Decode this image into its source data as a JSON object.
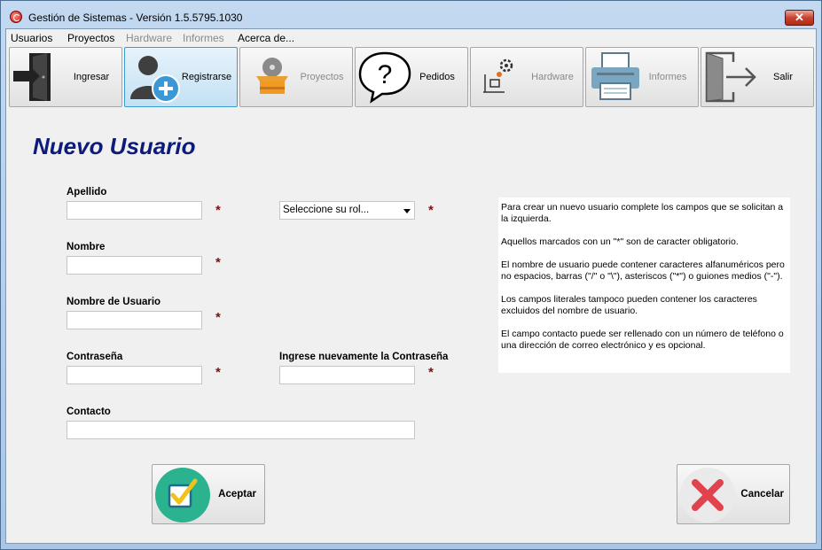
{
  "window": {
    "title": "Gestión de Sistemas - Versión 1.5.5795.1030",
    "close_glyph": "✕"
  },
  "menu": [
    {
      "label": "Usuarios",
      "enabled": true
    },
    {
      "label": "Proyectos",
      "enabled": true
    },
    {
      "label": "Hardware",
      "enabled": false
    },
    {
      "label": "Informes",
      "enabled": false
    },
    {
      "label": "Acerca de...",
      "enabled": true
    }
  ],
  "toolbar": [
    {
      "label": "Ingresar",
      "icon": "door-enter-icon",
      "enabled": true,
      "active": false
    },
    {
      "label": "Registrarse",
      "icon": "user-add-icon",
      "enabled": true,
      "active": true
    },
    {
      "label": "Proyectos",
      "icon": "box-disc-icon",
      "enabled": false,
      "active": false
    },
    {
      "label": "Pedidos",
      "icon": "question-bubble-icon",
      "enabled": true,
      "active": false
    },
    {
      "label": "Hardware",
      "icon": "hardware-gear-icon",
      "enabled": false,
      "active": false
    },
    {
      "label": "Informes",
      "icon": "printer-icon",
      "enabled": false,
      "active": false
    },
    {
      "label": "Salir",
      "icon": "door-exit-icon",
      "enabled": true,
      "active": false
    }
  ],
  "form": {
    "heading": "Nuevo Usuario",
    "apellido_label": "Apellido",
    "apellido_value": "",
    "nombre_label": "Nombre",
    "nombre_value": "",
    "usuario_label": "Nombre de Usuario",
    "usuario_value": "",
    "contrasena_label": "Contraseña",
    "contrasena_value": "",
    "repetir_label": "Ingrese nuevamente la Contraseña",
    "repetir_value": "",
    "contacto_label": "Contacto",
    "contacto_value": "",
    "rol_selected": "Seleccione su rol...",
    "required_mark": "*"
  },
  "info": {
    "paragraphs": [
      "Para crear un nuevo usuario complete los campos que se solicitan a la izquierda.",
      "Aquellos marcados con un \"*\" son de caracter obligatorio.",
      "El nombre de usuario puede contener caracteres alfanuméricos pero no espacios, barras (\"/\" o \"\\\"), asteriscos (\"*\") o guiones medios (\"-\").",
      "Los campos literales tampoco pueden contener los caracteres excluidos del nombre de usuario.",
      "El campo contacto puede ser rellenado con un número de teléfono o una dirección de correo electrónico y es opcional."
    ]
  },
  "buttons": {
    "aceptar": "Aceptar",
    "cancelar": "Cancelar"
  },
  "colors": {
    "heading": "#0d1b7a",
    "required": "#7b1111",
    "accept_green": "#2bb38f",
    "cancel_red": "#e0434e"
  }
}
